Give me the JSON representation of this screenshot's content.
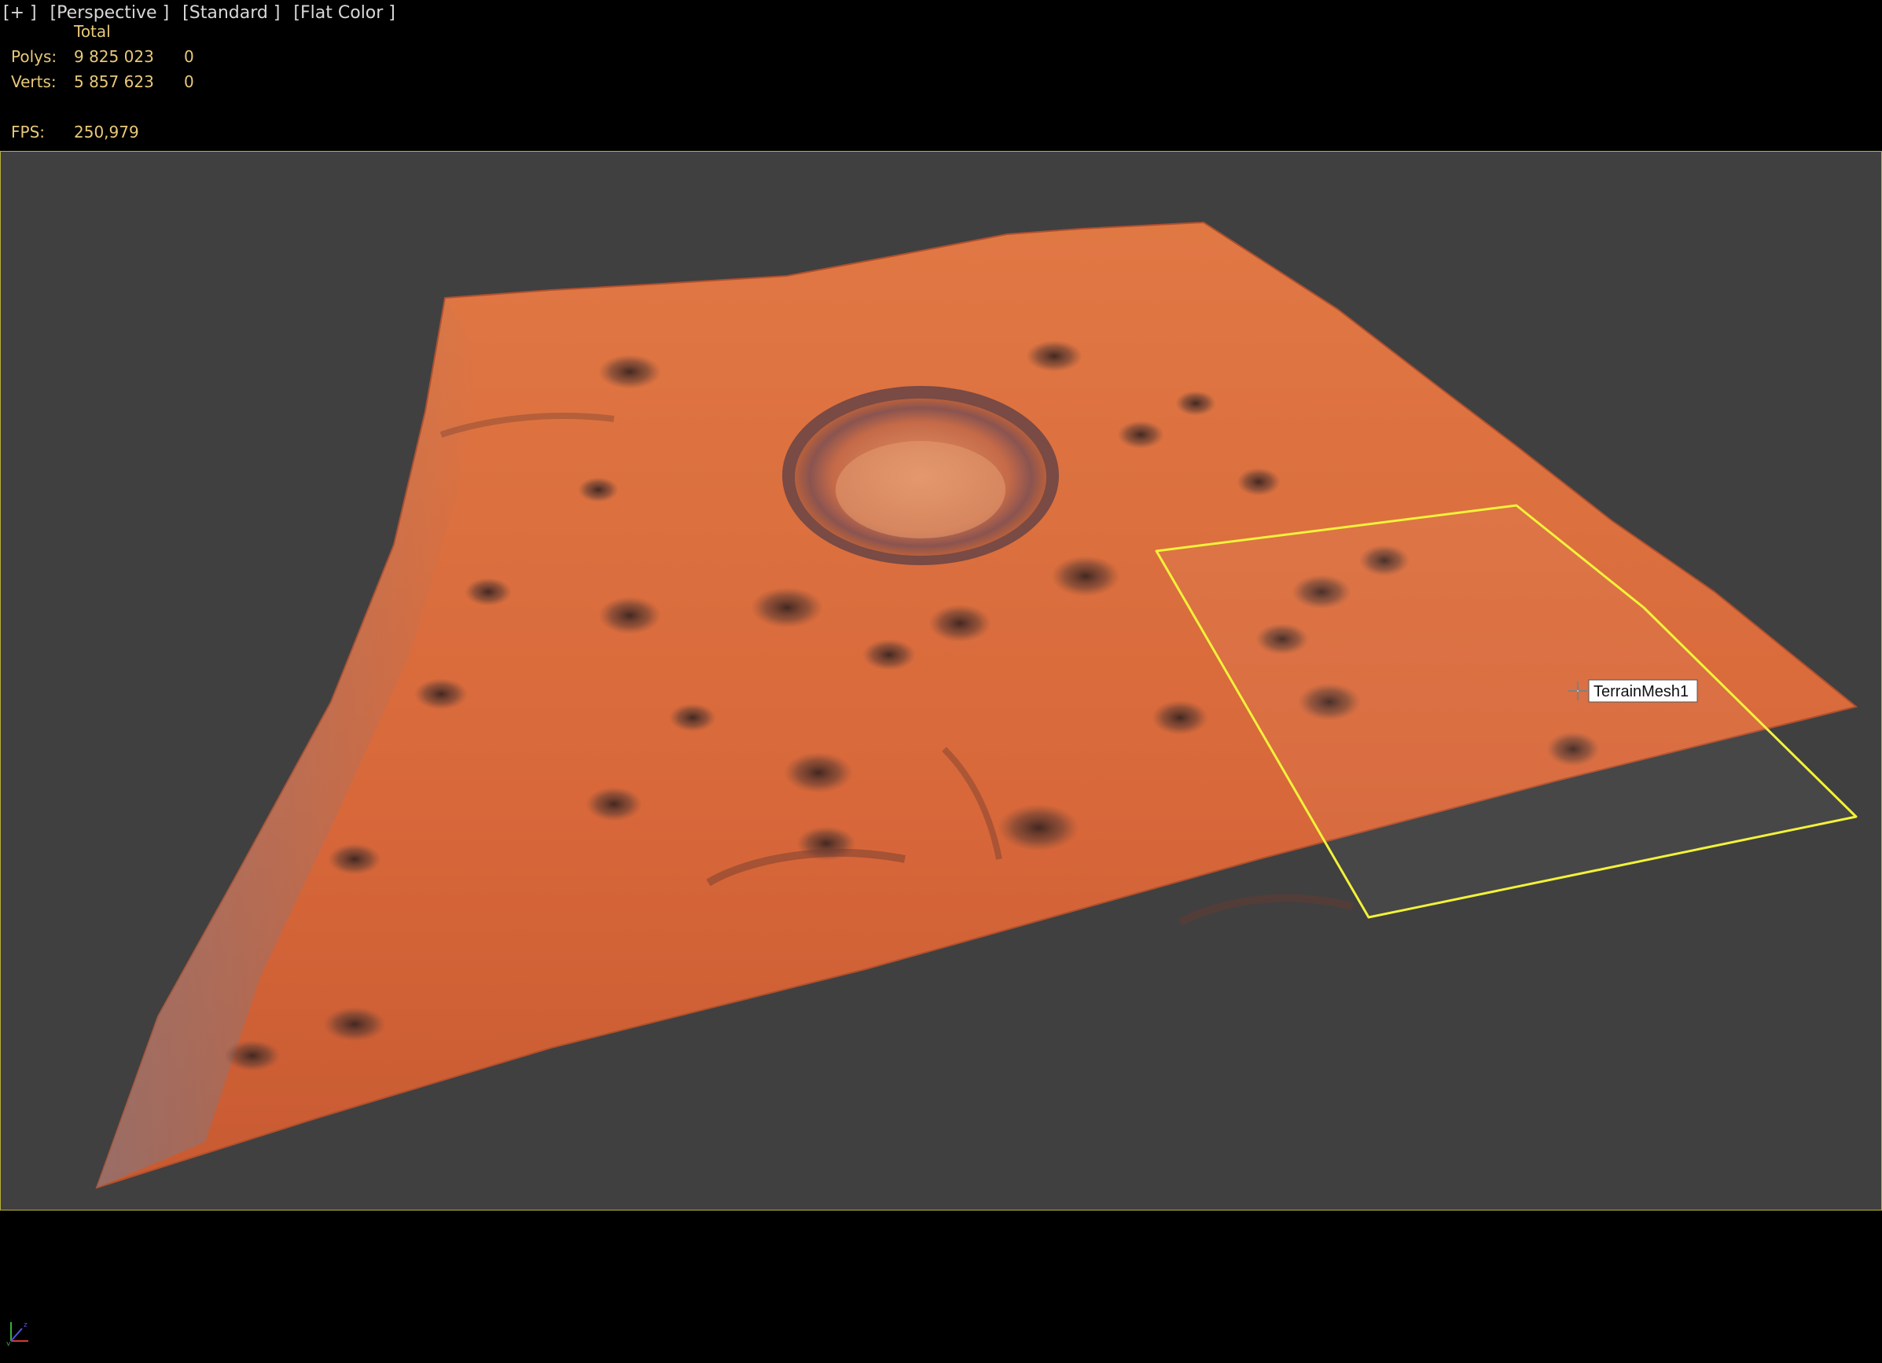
{
  "viewport_menu": {
    "plus": "[+ ]",
    "view": "[Perspective ]",
    "shading_style": "[Standard ]",
    "shading_mode": "[Flat Color ]"
  },
  "stats": {
    "header": "Total",
    "polys_label": "Polys:",
    "polys_total": "9 825 023",
    "polys_selected": "0",
    "verts_label": "Verts:",
    "verts_total": "5 857 623",
    "verts_selected": "0",
    "fps_label": "FPS:",
    "fps_value": "250,979"
  },
  "scene": {
    "hover_tooltip": "TerrainMesh1"
  },
  "colors": {
    "viewport_bg": "#404040",
    "viewport_border": "#b8b038",
    "terrain": "#d9683a",
    "selection": "#f2f23a",
    "stats_text": "#e8c97a"
  },
  "icons": {
    "cursor": "move-crosshair-icon",
    "axis": "axis-gizmo-icon"
  }
}
